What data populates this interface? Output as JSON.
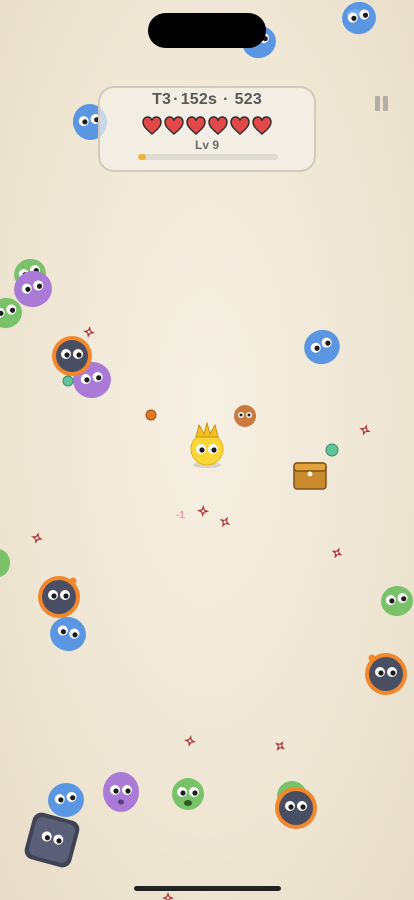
{
  "hud": {
    "stage": "T3",
    "time": "152s",
    "score": "523",
    "separator": "·",
    "level": "Lv 9",
    "hearts": 6,
    "xp_fraction": 0.06
  },
  "colors": {
    "background": "#f2ebdc",
    "heart": "#e2474a",
    "xp": "#f0b43a",
    "blue": "#5b96e3",
    "green": "#7ac26a",
    "purple": "#a97ad6",
    "bomb_body": "#4a4e63",
    "bomb_ring": "#f2872c",
    "player": "#f8d637"
  },
  "floating_text": "-1",
  "icons": {
    "pause": "pause-icon",
    "heart": "heart-icon",
    "chest": "treasure-chest-icon",
    "shuriken": "shuriken-icon",
    "gem": "xp-gem-icon",
    "crown": "crown-icon"
  }
}
